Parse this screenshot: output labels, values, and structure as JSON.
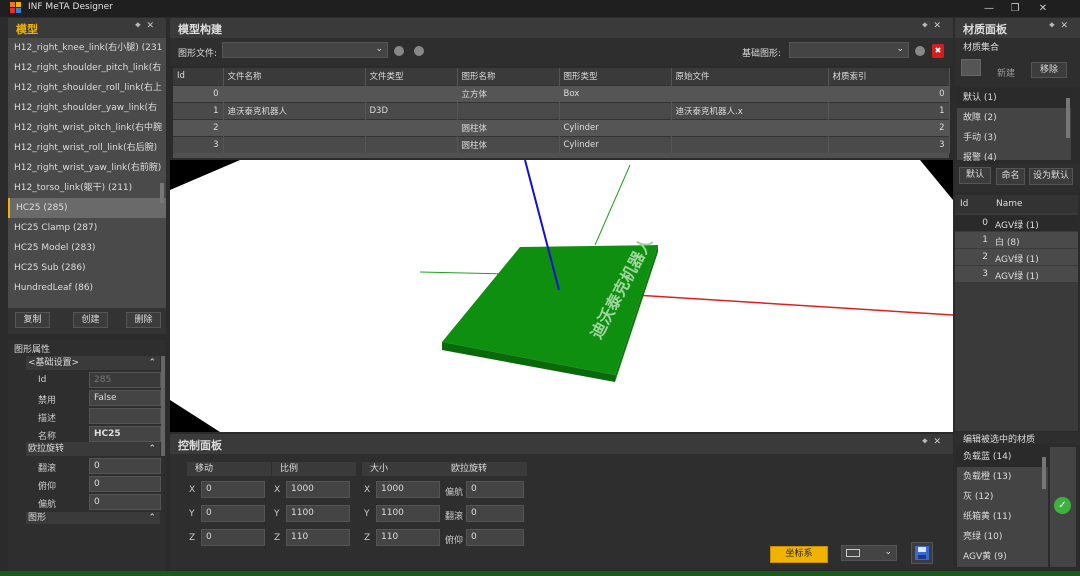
{
  "app": {
    "title": "INF MeTA Designer"
  },
  "model_panel": {
    "title": "模型",
    "items": [
      "H12_right_knee_link(右小腿) (231",
      "H12_right_shoulder_pitch_link(右",
      "H12_right_shoulder_roll_link(右上",
      "H12_right_shoulder_yaw_link(右",
      "H12_right_wrist_pitch_link(右中腕",
      "H12_right_wrist_roll_link(右后腕)",
      "H12_right_wrist_yaw_link(右前腕)",
      "H12_torso_link(躯干) (211)",
      "HC25 (285)",
      "HC25 Clamp (287)",
      "HC25 Model (283)",
      "HC25 Sub (286)",
      "HundredLeaf (86)"
    ],
    "copy_label": "复制",
    "create_label": "创建",
    "delete_label": "删除"
  },
  "props_panel": {
    "title": "图形属性",
    "group1": "<基础设置>",
    "rows1": [
      {
        "label": "Id",
        "value": "285"
      },
      {
        "label": "禁用",
        "value": "False"
      },
      {
        "label": "描述",
        "value": ""
      },
      {
        "label": "名称",
        "value": "HC25"
      }
    ],
    "group2": "欧拉旋转",
    "rows2": [
      {
        "label": "翻滚",
        "value": "0"
      },
      {
        "label": "俯仰",
        "value": "0"
      },
      {
        "label": "偏航",
        "value": "0"
      }
    ],
    "group3": "图形"
  },
  "build_panel": {
    "title": "模型构建",
    "file_label": "图形文件:",
    "base_label": "基础图形:",
    "columns": [
      "Id",
      "文件名称",
      "文件类型",
      "图形名称",
      "图形类型",
      "原始文件",
      "材质索引"
    ],
    "rows": [
      [
        "0",
        "",
        "",
        "立方体",
        "Box",
        "",
        "0"
      ],
      [
        "1",
        "迪沃泰克机器人",
        "D3D",
        "",
        "",
        "迪沃泰克机器人.x",
        "1"
      ],
      [
        "2",
        "",
        "",
        "圆柱体",
        "Cylinder",
        "",
        "2"
      ],
      [
        "3",
        "",
        "",
        "圆柱体",
        "Cylinder",
        "",
        "3"
      ]
    ]
  },
  "viewport": {
    "plate_text": "迪沃泰克机器人"
  },
  "control_panel": {
    "title": "控制面板",
    "groups": [
      {
        "title": "移动",
        "x": "0",
        "y": "0",
        "z": "0"
      },
      {
        "title": "比例",
        "x": "1000",
        "y": "1100",
        "z": "110"
      },
      {
        "title": "大小",
        "x": "1000",
        "y": "1100",
        "z": "110"
      }
    ],
    "rotation": {
      "title": "欧拉旋转",
      "labels": [
        "偏航",
        "翻滚",
        "俯仰"
      ],
      "values": [
        "0",
        "0",
        "0"
      ]
    },
    "axes": [
      "X",
      "Y",
      "Z"
    ],
    "coord_button": "坐标系"
  },
  "material_panel": {
    "title": "材质面板",
    "set_title": "材质集合",
    "new_label": "新建",
    "remove_label": "移除",
    "sets": [
      "默认 (1)",
      "故障 (2)",
      "手动 (3)",
      "报警 (4)"
    ],
    "default_btn": "默认",
    "rename_btn": "命名",
    "set_default_btn": "设为默认",
    "columns": [
      "Id",
      "Name"
    ],
    "materials": [
      {
        "id": "0",
        "name": "AGV绿 (1)"
      },
      {
        "id": "1",
        "name": "白 (8)"
      },
      {
        "id": "2",
        "name": "AGV绿 (1)"
      },
      {
        "id": "3",
        "name": "AGV绿 (1)"
      }
    ],
    "edit_title": "编辑被选中的材质",
    "edit_items": [
      "负载蓝 (14)",
      "负载橙 (13)",
      "灰 (12)",
      "纸箱黄 (11)",
      "亮绿 (10)",
      "AGV黄 (9)"
    ]
  },
  "colors": {
    "accent": "#f0b400",
    "plate": "#0f8f0f",
    "ok": "#3cb43c"
  }
}
